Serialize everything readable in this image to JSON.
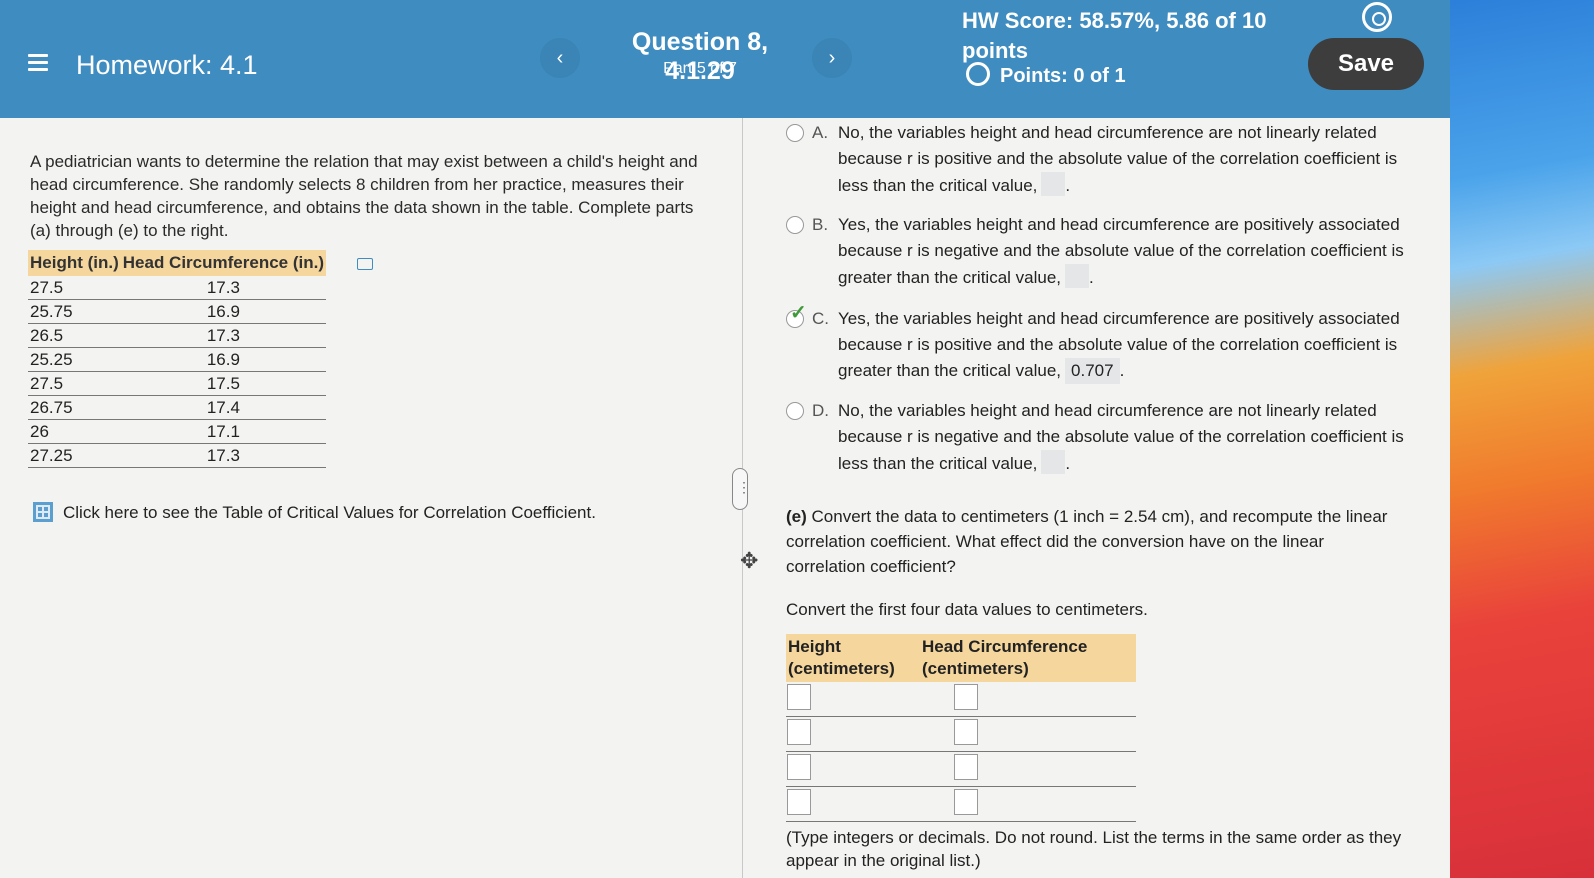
{
  "header": {
    "title": "Homework: 4.1",
    "question": "Question 8, 4.1.29",
    "part": "Part 5 of 7",
    "score": "HW Score: 58.57%, 5.86 of 10 points",
    "points": "Points: 0 of 1",
    "save_label": "Save",
    "prev": "‹",
    "next": "›"
  },
  "intro": "A pediatrician wants to determine the relation that may exist between a child's height and head circumference. She randomly selects 8 children from her practice, measures their height and head circumference, and obtains the data shown in the table. Complete parts (a) through (e) to the right.",
  "data_table": {
    "headers": [
      "Height (in.)",
      "Head Circumference (in.)"
    ],
    "rows": [
      [
        "27.5",
        "17.3"
      ],
      [
        "25.75",
        "16.9"
      ],
      [
        "26.5",
        "17.3"
      ],
      [
        "25.25",
        "16.9"
      ],
      [
        "27.5",
        "17.5"
      ],
      [
        "26.75",
        "17.4"
      ],
      [
        "26",
        "17.1"
      ],
      [
        "27.25",
        "17.3"
      ]
    ]
  },
  "critical_link": "Click here to see the Table of Critical Values for Correlation Coefficient.",
  "choices": [
    {
      "letter": "A.",
      "text": "No, the variables height and head circumference are not linearly related because r is positive and the absolute value of the correlation coefficient is less than the critical value,"
    },
    {
      "letter": "B.",
      "text": "Yes, the variables height and head circumference are positively associated because r is negative and the absolute value of the correlation coefficient is greater than the critical value,"
    },
    {
      "letter": "C.",
      "text": "Yes, the variables height and head circumference are positively associated because r is positive and the absolute value of the correlation coefficient is greater than the critical value,",
      "value": "0.707"
    },
    {
      "letter": "D.",
      "text": "No, the variables height and head circumference are not linearly related because r is negative and the absolute value of the correlation coefficient is less than the critical value,"
    }
  ],
  "part_e": {
    "label": "(e)",
    "text": "Convert the data to centimeters (1 inch = 2.54 cm), and recompute the linear correlation coefficient. What effect did the conversion have on the linear correlation coefficient?",
    "convert": "Convert the first four data values to centimeters.",
    "headers": [
      "Height (centimeters)",
      "Head Circumference (centimeters)"
    ],
    "note": "(Type integers or decimals. Do not round. List the terms in the same order as they appear in the original list.)"
  }
}
